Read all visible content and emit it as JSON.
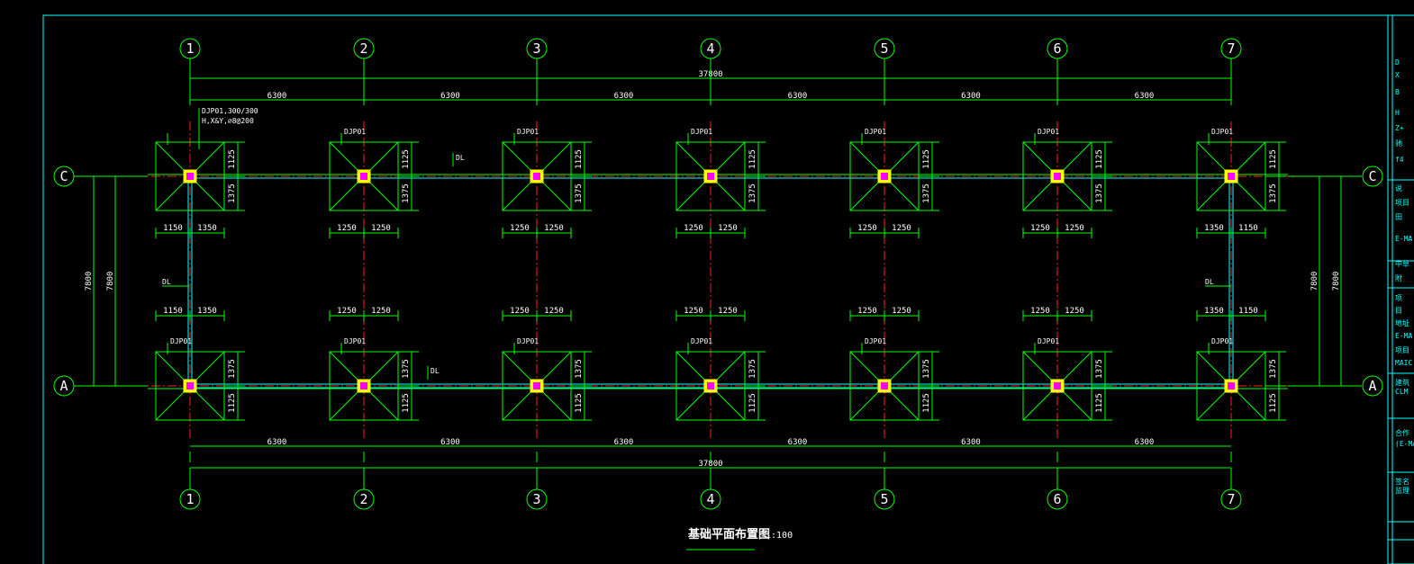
{
  "drawing": {
    "title": "基础平面布置图",
    "scale": "1:100",
    "grid_columns": [
      "1",
      "2",
      "3",
      "4",
      "5",
      "6",
      "7"
    ],
    "grid_rows": [
      "C",
      "A"
    ],
    "total_length": "37800",
    "bay_spacing": [
      "6300",
      "6300",
      "6300",
      "6300",
      "6300",
      "6300"
    ],
    "row_spacing": "7800",
    "footing_tag_main": "DJP01,300/300",
    "footing_tag_sub": "H,X&Y,⌀8@200",
    "footing_tag": "DJP01",
    "beam_tag": "DL",
    "dims": {
      "c_upper": "1125",
      "c_lower": "1375",
      "a_upper": "1375",
      "a_lower": "1125",
      "edge_left_a": "1150",
      "edge_left_b": "1350",
      "edge_right_a": "1350",
      "edge_right_b": "1150",
      "inner_half": "1250"
    }
  },
  "title_block": {
    "labels": [
      "D",
      "X",
      "B",
      "H",
      "Z+",
      "驰",
      "f4",
      "说",
      "项目",
      "田",
      "E-MA",
      "中草",
      "附",
      "项",
      "目",
      "地址",
      "E-MA",
      "项目",
      "MAIC",
      "建筑",
      "CLM",
      "合作",
      "(E-MA",
      "签名",
      "监理"
    ]
  }
}
